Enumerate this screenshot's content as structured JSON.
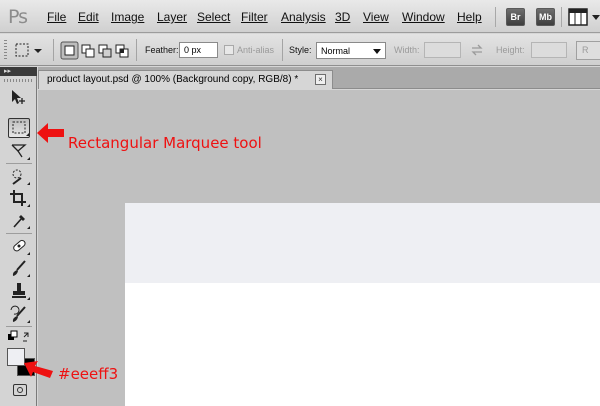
{
  "app": {
    "logo": "Ps"
  },
  "menu": {
    "items": [
      {
        "label": "File"
      },
      {
        "label": "Edit"
      },
      {
        "label": "Image"
      },
      {
        "label": "Layer"
      },
      {
        "label": "Select"
      },
      {
        "label": "Filter"
      },
      {
        "label": "Analysis"
      },
      {
        "label": "3D"
      },
      {
        "label": "View"
      },
      {
        "label": "Window"
      },
      {
        "label": "Help"
      }
    ],
    "bridge_label": "Br",
    "minibridge_label": "Mb"
  },
  "options": {
    "feather_label": "Feather:",
    "feather_value": "0 px",
    "antialias_label": "Anti-alias",
    "style_label": "Style:",
    "style_value": "Normal",
    "width_label": "Width:",
    "height_label": "Height:",
    "refine_label": "R"
  },
  "document": {
    "tab_title": "product layout.psd @ 100% (Background copy, RGB/8) *",
    "close_glyph": "×",
    "band_color": "#eeeff3",
    "canvas_color": "#ffffff"
  },
  "toolbox": {
    "collapse_glyph": "▸▸",
    "tools": [
      {
        "name": "move"
      },
      {
        "name": "rectangular-marquee",
        "active": true
      },
      {
        "name": "lasso"
      },
      {
        "name": "quick-selection"
      },
      {
        "name": "crop"
      },
      {
        "name": "eyedropper"
      },
      {
        "name": "spot-healing"
      },
      {
        "name": "brush"
      },
      {
        "name": "clone-stamp"
      },
      {
        "name": "history-brush"
      }
    ],
    "foreground_color": "#eeeff3",
    "background_color": "#000000"
  },
  "annotations": {
    "marquee_note": "Rectangular Marquee tool",
    "color_note": "#eeeff3",
    "color": "#ee1111"
  }
}
